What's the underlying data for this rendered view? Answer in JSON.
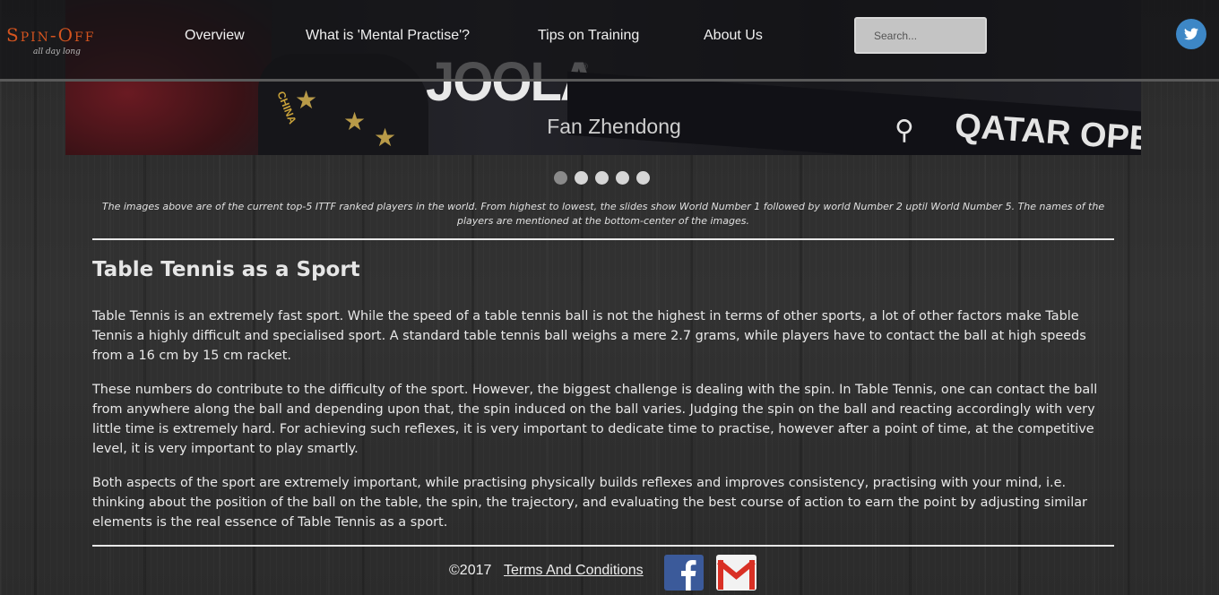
{
  "header": {
    "logo_name": "Spin-Off",
    "logo_tagline": "all day long",
    "nav": [
      "Overview",
      "What is 'Mental Practise'?",
      "Tips on Training",
      "About Us"
    ],
    "search_placeholder": "Search..."
  },
  "slider": {
    "brand_text": "JOOLA",
    "jersey_text": "CHINA",
    "event_text": "QATAR OPEN",
    "caption": "Fan Zhendong",
    "slide_count": 5,
    "active_slide": 1
  },
  "slider_note": "The images above are of the current top-5 ITTF ranked players in the world. From highest to lowest, the slides show World Number 1 followed by world Number 2 uptil World Number 5. The names of the players are mentioned at the bottom-center of the images.",
  "article": {
    "title": "Table Tennis as a Sport",
    "paragraphs": [
      "Table Tennis is an extremely fast sport. While the speed of a table tennis ball is not the highest in terms of other sports, a lot of other factors make Table Tennis a highly difficult and specialised sport. A standard table tennis ball weighs a mere 2.7 grams, while players have to contact the ball at high speeds from a 16 cm by 15 cm racket.",
      "These numbers do contribute to the difficulty of the sport. However, the biggest challenge is dealing with the spin. In Table Tennis, one can contact the ball from anywhere along the ball and depending upon that, the spin induced on the ball varies. Judging the spin on the ball and reacting accordingly with very little time is extremely hard. For achieving such reflexes, it is very important to dedicate time to practise, however after a point of time, at the competitive level, it is very important to play smartly.",
      "Both aspects of the sport are extremely important, while practising physically builds reflexes and improves consistency, practising with your mind, i.e. thinking about the position of the ball on the table, the spin, the trajectory, and evaluating the best course of action to earn the point by adjusting similar elements is the real essence of Table Tennis as a sport."
    ]
  },
  "footer": {
    "copyright": "©2017",
    "terms": "Terms And Conditions"
  },
  "colors": {
    "logo": "#d4541f",
    "twitter": "#3d87c6",
    "facebook": "#3b5a9a",
    "gmail_red": "#d93025"
  }
}
